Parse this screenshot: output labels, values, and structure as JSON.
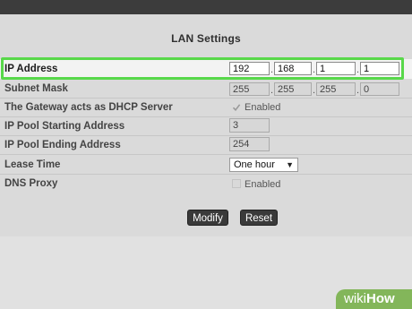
{
  "page": {
    "title": "LAN Settings"
  },
  "rows": {
    "ip_address": {
      "label": "IP Address",
      "octets": [
        "192",
        "168",
        "1",
        "1"
      ]
    },
    "subnet_mask": {
      "label": "Subnet Mask",
      "octets": [
        "255",
        "255",
        "255",
        "0"
      ]
    },
    "dhcp": {
      "label": "The Gateway acts as DHCP Server",
      "option": "Enabled"
    },
    "pool_start": {
      "label": "IP Pool Starting Address",
      "value": "3"
    },
    "pool_end": {
      "label": "IP Pool Ending Address",
      "value": "254"
    },
    "lease": {
      "label": "Lease Time",
      "selected": "One hour"
    },
    "dns_proxy": {
      "label": "DNS Proxy",
      "option": "Enabled"
    }
  },
  "buttons": {
    "modify": "Modify",
    "reset": "Reset"
  },
  "watermark": {
    "part1": "wiki",
    "part2": "How"
  },
  "colors": {
    "highlight": "#58d84a",
    "watermark": "#83b65a",
    "button": "#3a3a3a"
  }
}
